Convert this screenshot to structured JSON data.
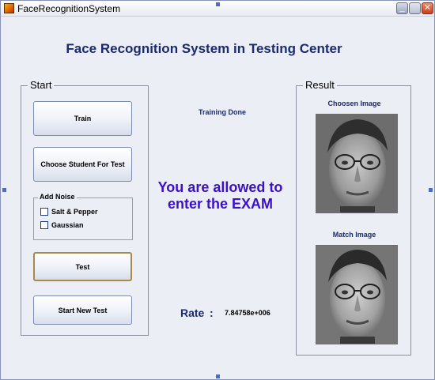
{
  "window": {
    "title": "FaceRecognitionSystem",
    "buttons": {
      "minimize": "_",
      "maximize": "□",
      "close": "✕"
    }
  },
  "app": {
    "heading": "Face Recognition System  in Testing Center"
  },
  "start_panel": {
    "title": "Start",
    "train_button": "Train",
    "choose_button": "Choose Student For Test",
    "noise": {
      "title": "Add Noise",
      "salt_pepper": "Salt & Pepper",
      "gaussian": "Gaussian"
    },
    "test_button": "Test",
    "new_test_button": "Start New Test"
  },
  "status": {
    "training": "Training Done",
    "exam_message": "You are allowed to enter the EXAM"
  },
  "rate": {
    "label": "Rate",
    "colon": ":",
    "value": "7.84758e+006"
  },
  "result_panel": {
    "title": "Result",
    "chosen_caption": "Choosen Image",
    "match_caption": "Match Image"
  },
  "colors": {
    "heading": "#1a2a6e",
    "exam_message": "#3a10c8",
    "background": "#eceef6"
  }
}
